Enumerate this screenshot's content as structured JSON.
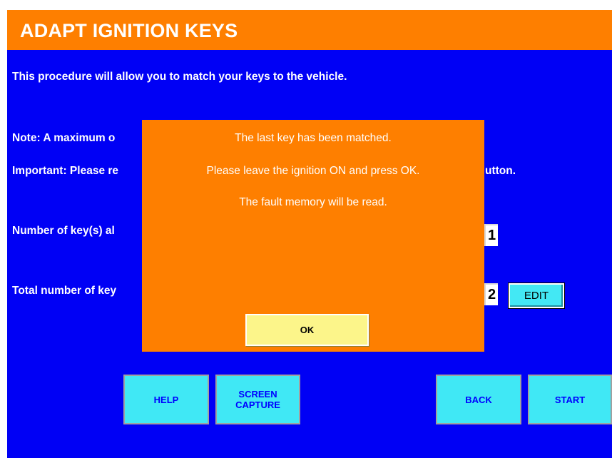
{
  "header": {
    "title": "ADAPT IGNITION KEYS"
  },
  "body": {
    "intro": "This procedure will allow you to match your keys to the vehicle.",
    "note_visible": "Note: A maximum o",
    "important_visible_left": "Important: Please re",
    "important_visible_right": "utton.",
    "keys_already_label_visible": "Number of key(s) al",
    "keys_already_value": "1",
    "total_keys_label_visible": "Total number of key",
    "total_keys_value": "2",
    "edit_label": "EDIT"
  },
  "dialog": {
    "line1": "The last key has been matched.",
    "line2": "Please leave the ignition ON and press OK.",
    "line3": "The fault memory will be read.",
    "ok_label": "OK"
  },
  "footer": {
    "help_label": "HELP",
    "screen_capture_line1": "SCREEN",
    "screen_capture_line2": "CAPTURE",
    "back_label": "BACK",
    "start_label": "START"
  },
  "colors": {
    "background": "#0000f5",
    "accent_orange": "#fe7f00",
    "button_cyan": "#40e8f5",
    "ok_yellow": "#fcf58a"
  }
}
